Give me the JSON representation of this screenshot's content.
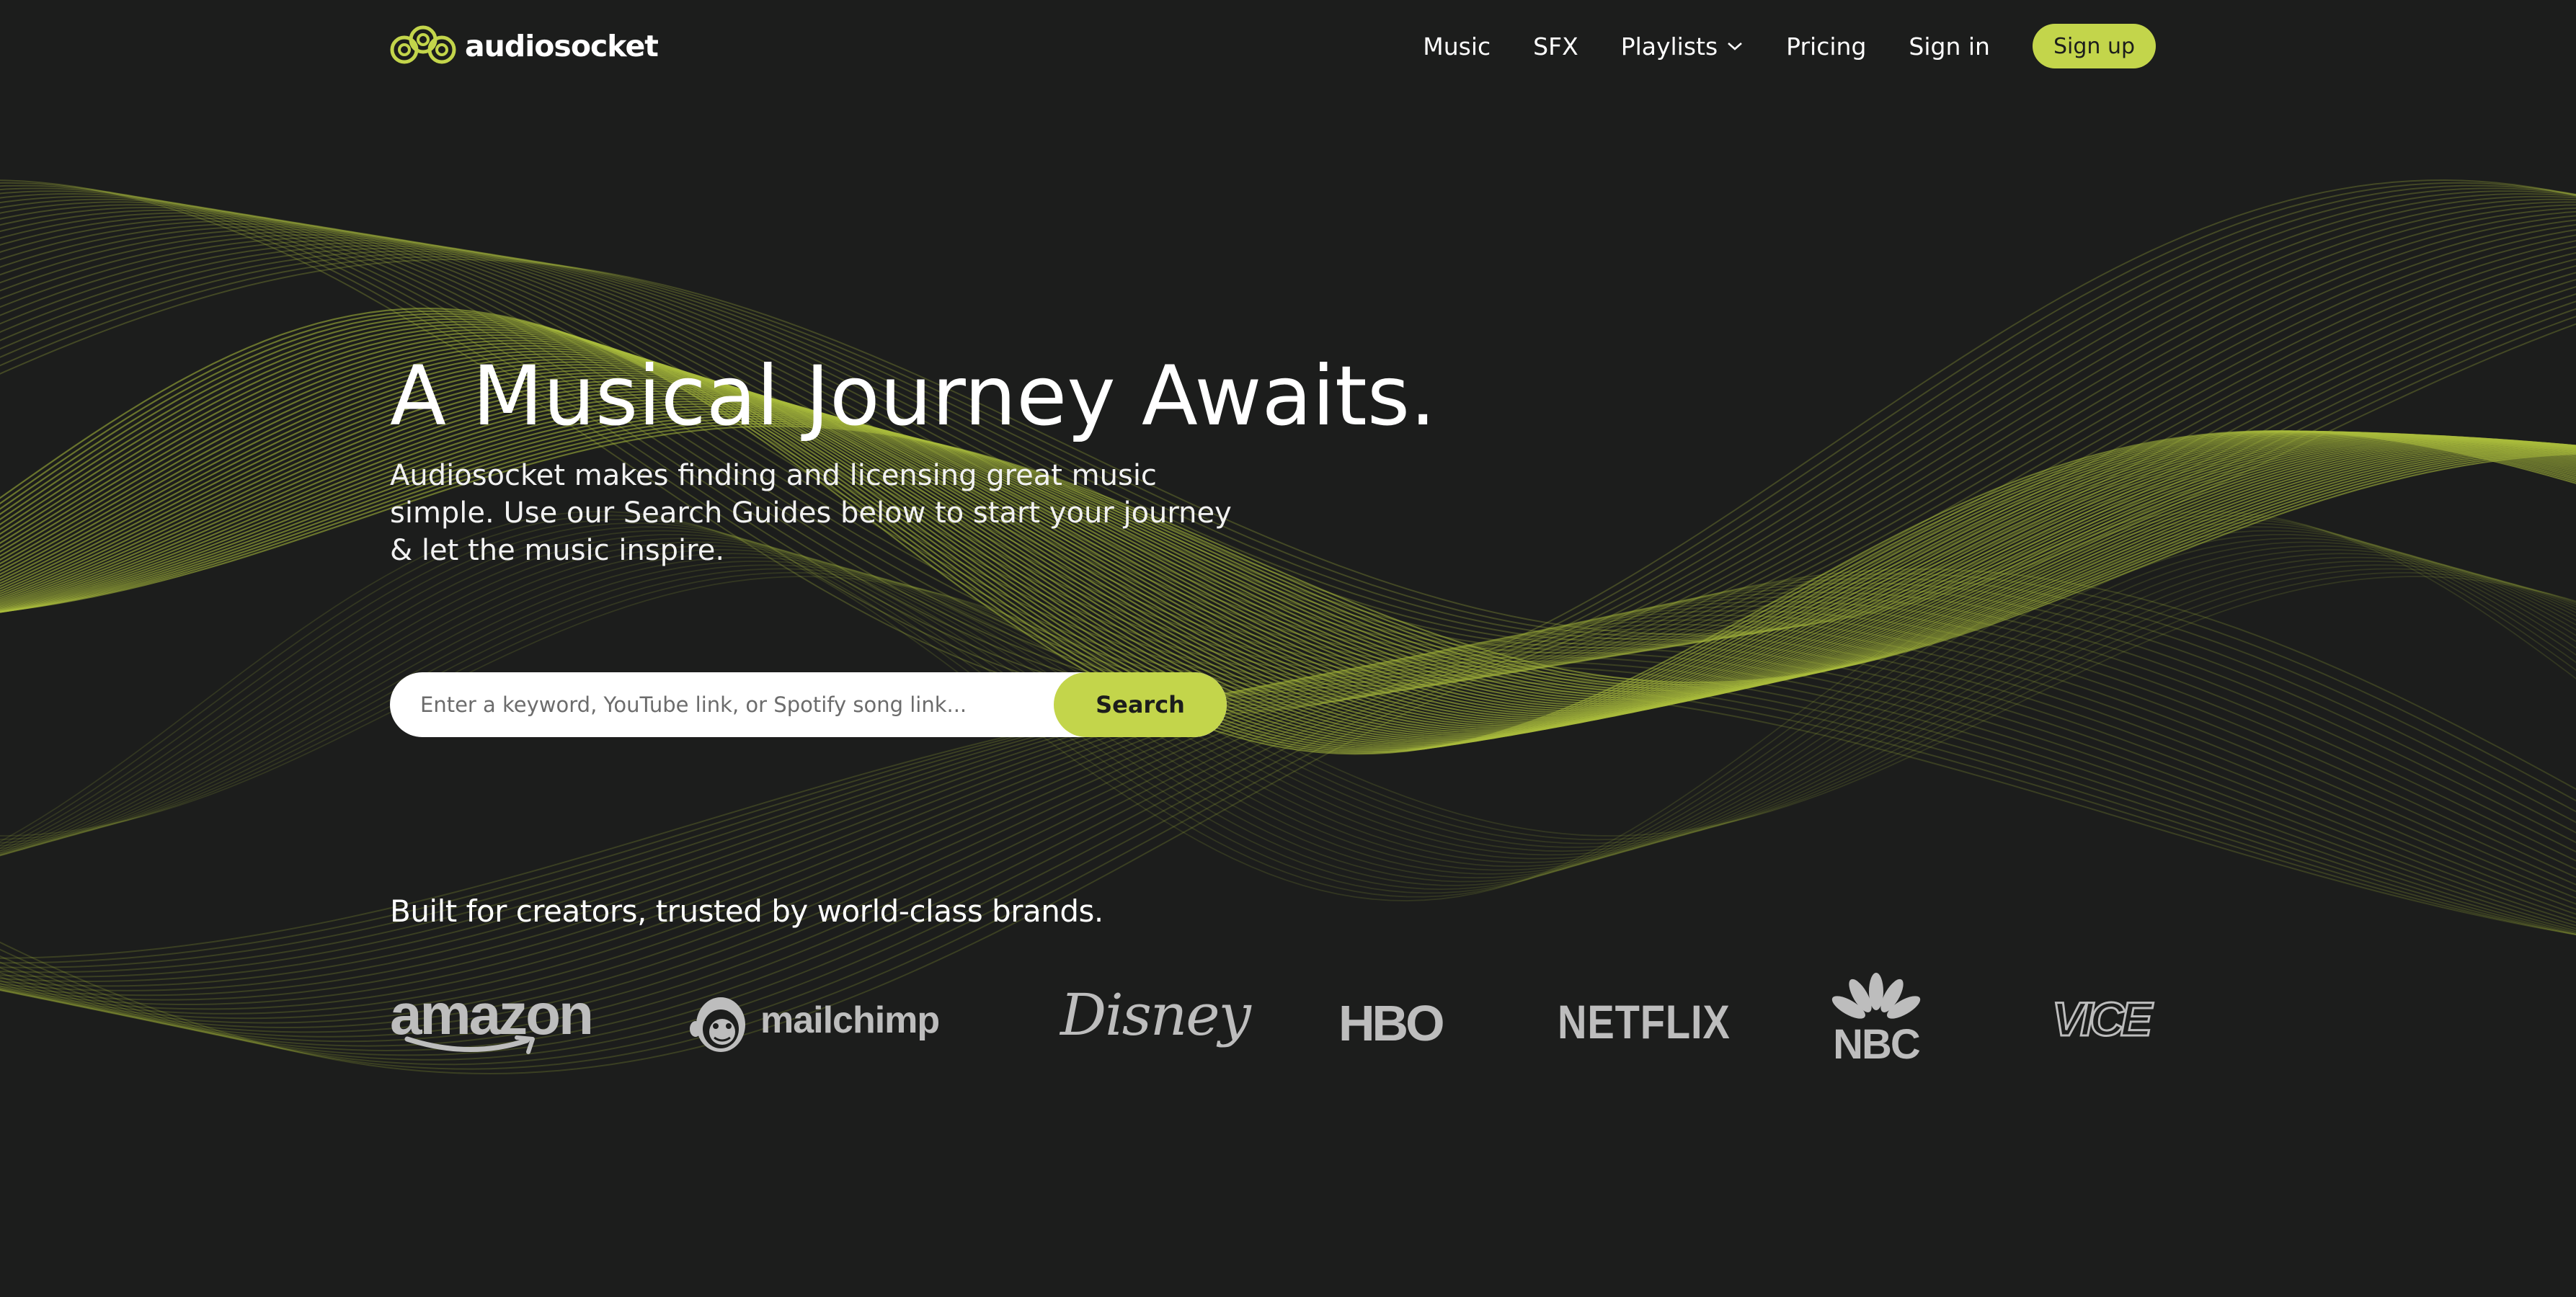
{
  "colors": {
    "background": "#1c1d1c",
    "accent": "#c3d54b",
    "wave": "#a9bb3c",
    "logo_gray": "#bdbdbd"
  },
  "nav": {
    "logo_icon": "audiosocket-logo-icon",
    "logo_text": "audiosocket",
    "links": [
      {
        "label": "Music"
      },
      {
        "label": "SFX"
      },
      {
        "label": "Playlists",
        "icon": "chevron-down-icon"
      },
      {
        "label": "Pricing"
      },
      {
        "label": "Sign in"
      }
    ],
    "signup_label": "Sign up"
  },
  "hero": {
    "title": "A Musical Journey Awaits.",
    "subtitle": "Audiosocket makes finding and licensing great music simple. Use our Search Guides below to start your journey & let the music inspire."
  },
  "search": {
    "placeholder": "Enter a keyword, YouTube link, or Spotify song link...",
    "value": "",
    "button_label": "Search"
  },
  "trusted": {
    "text": "Built for creators, trusted by world-class brands."
  },
  "brands": [
    {
      "name": "amazon"
    },
    {
      "name": "mailchimp",
      "icon": "mailchimp-freddie-icon"
    },
    {
      "name": "Disney"
    },
    {
      "name": "HBO"
    },
    {
      "name": "NETFLIX"
    },
    {
      "name": "NBC",
      "icon": "nbc-peacock-icon"
    },
    {
      "name": "VICE"
    }
  ]
}
